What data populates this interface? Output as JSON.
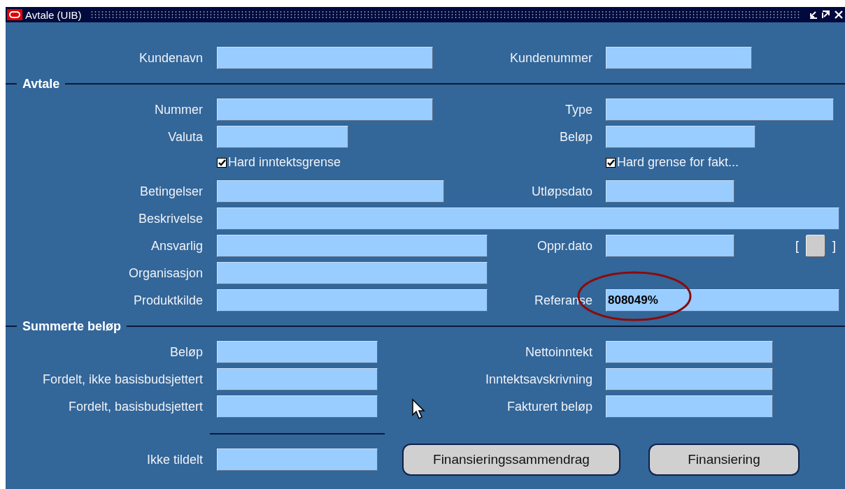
{
  "window": {
    "title": "Avtale (UIB)"
  },
  "top_row": {
    "left": {
      "label": "Kundenavn"
    },
    "right": {
      "label": "Kundenummer"
    }
  },
  "sections": [
    {
      "title": "Avtale",
      "rows": [
        {
          "kind": "pair",
          "left": {
            "label": "Nummer"
          },
          "right": {
            "label": "Type"
          }
        },
        {
          "kind": "pair",
          "left": {
            "label": "Valuta"
          },
          "right": {
            "label": "Beløp"
          }
        },
        {
          "kind": "checks",
          "left": {
            "label": "Hard inntektsgrense",
            "checked": true
          },
          "right": {
            "label": "Hard grense for fakt...",
            "checked": true
          }
        },
        {
          "kind": "pair",
          "left": {
            "label": "Betingelser"
          },
          "right": {
            "label": "Utløpsdato"
          }
        },
        {
          "kind": "wide",
          "left": {
            "label": "Beskrivelse"
          }
        },
        {
          "kind": "pair",
          "left": {
            "label": "Ansvarlig"
          },
          "right": {
            "label": "Oppr.dato"
          },
          "extra": {
            "open": "[",
            "close": "]"
          }
        },
        {
          "kind": "pair",
          "left": {
            "label": "Organisasjon"
          }
        },
        {
          "kind": "pair",
          "left": {
            "label": "Produktkilde"
          },
          "right": {
            "label": "Referanse",
            "value": "808049%",
            "circled": true
          }
        }
      ]
    },
    {
      "title": "Summerte beløp",
      "rows": [
        {
          "kind": "pair",
          "left": {
            "label": "Beløp"
          },
          "right": {
            "label": "Nettoinntekt"
          }
        },
        {
          "kind": "pair",
          "left": {
            "label": "Fordelt, ikke basisbudsjettert"
          },
          "right": {
            "label": "Inntektsavskrivning"
          }
        },
        {
          "kind": "pair",
          "left": {
            "label": "Fordelt, basisbudsjettert"
          },
          "right": {
            "label": "Fakturert beløp"
          }
        },
        {
          "kind": "rule"
        },
        {
          "kind": "buttons",
          "left": {
            "label": "Ikke tildelt"
          },
          "buttons": [
            {
              "label": "Finansieringssammendrag"
            },
            {
              "label": "Finansiering"
            }
          ]
        }
      ]
    }
  ]
}
